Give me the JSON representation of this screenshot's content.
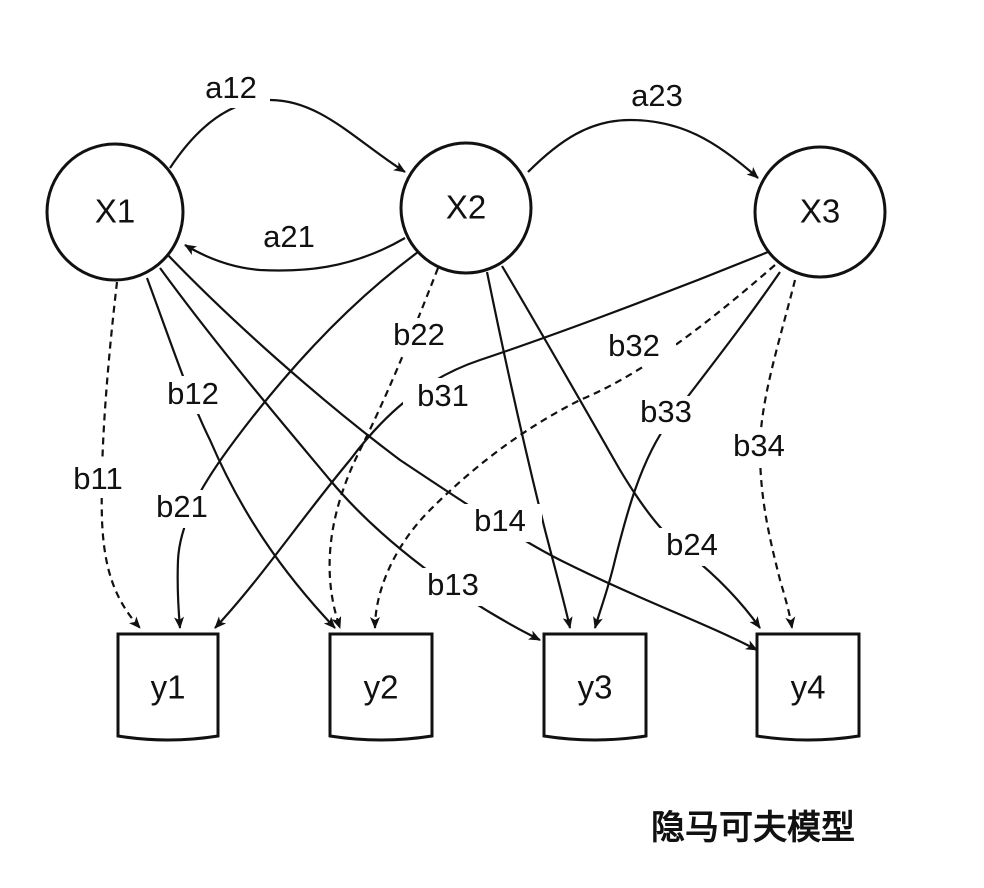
{
  "diagram": {
    "hidden_states": [
      {
        "id": "x1",
        "label": "X1"
      },
      {
        "id": "x2",
        "label": "X2"
      },
      {
        "id": "x3",
        "label": "X3"
      }
    ],
    "observations": [
      {
        "id": "y1",
        "label": "y1"
      },
      {
        "id": "y2",
        "label": "y2"
      },
      {
        "id": "y3",
        "label": "y3"
      },
      {
        "id": "y4",
        "label": "y4"
      }
    ],
    "transitions": [
      {
        "id": "a12",
        "label": "a12",
        "from": "X1",
        "to": "X2"
      },
      {
        "id": "a21",
        "label": "a21",
        "from": "X2",
        "to": "X1"
      },
      {
        "id": "a23",
        "label": "a23",
        "from": "X2",
        "to": "X3"
      }
    ],
    "emissions": [
      {
        "id": "b11",
        "label": "b11",
        "from": "X1",
        "to": "y1"
      },
      {
        "id": "b12",
        "label": "b12",
        "from": "X1",
        "to": "y2"
      },
      {
        "id": "b13",
        "label": "b13",
        "from": "X1",
        "to": "y3"
      },
      {
        "id": "b14",
        "label": "b14",
        "from": "X1",
        "to": "y4"
      },
      {
        "id": "b21",
        "label": "b21",
        "from": "X2",
        "to": "y1"
      },
      {
        "id": "b22",
        "label": "b22",
        "from": "X2",
        "to": "y2"
      },
      {
        "id": "b23",
        "label": "",
        "from": "X2",
        "to": "y3"
      },
      {
        "id": "b24",
        "label": "b24",
        "from": "X2",
        "to": "y4"
      },
      {
        "id": "b31",
        "label": "b31",
        "from": "X3",
        "to": "y1"
      },
      {
        "id": "b32",
        "label": "b32",
        "from": "X3",
        "to": "y2"
      },
      {
        "id": "b33",
        "label": "b33",
        "from": "X3",
        "to": "y3"
      },
      {
        "id": "b34",
        "label": "b34",
        "from": "X3",
        "to": "y4"
      }
    ],
    "caption": "隐马可夫模型"
  }
}
